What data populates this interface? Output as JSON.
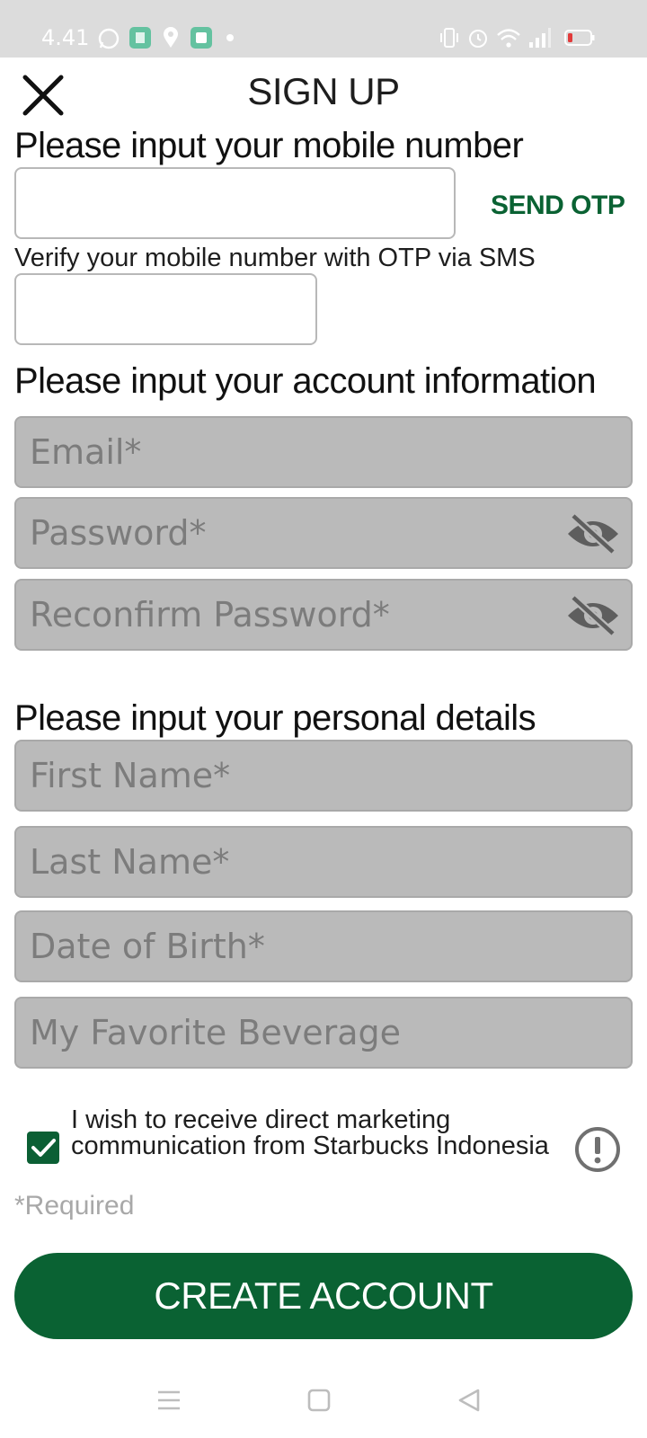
{
  "status_bar": {
    "time": "4.41",
    "left_icons": [
      "whatsapp-icon",
      "app-notification-icon",
      "location-icon",
      "app-notification-icon",
      "dot-icon"
    ],
    "right_icons": [
      "vibrate-icon",
      "alarm-icon",
      "wifi-icon",
      "signal-icon",
      "battery-low-icon"
    ]
  },
  "header": {
    "title": "SIGN UP",
    "close_icon": "close-icon"
  },
  "mobile_section": {
    "heading": "Please input your mobile number",
    "phone_value": "",
    "send_otp_label": "SEND OTP",
    "otp_hint": "Verify your mobile number with OTP via SMS",
    "otp_value": ""
  },
  "account_section": {
    "heading": "Please input your account information",
    "email_placeholder": "Email*",
    "password_placeholder": "Password*",
    "reconfirm_placeholder": "Reconfirm Password*"
  },
  "personal_section": {
    "heading": "Please input your personal details",
    "first_name_placeholder": "First Name*",
    "last_name_placeholder": "Last Name*",
    "dob_placeholder": "Date of Birth*",
    "beverage_placeholder": "My Favorite Beverage"
  },
  "marketing": {
    "checked": true,
    "text": "I wish to receive direct marketing communication from Starbucks Indonesia"
  },
  "required_note": "*Required",
  "create_account_label": "CREATE ACCOUNT",
  "colors": {
    "brand_green": "#0a6233",
    "field_gray": "#bababa",
    "status_bar_bg": "#dcdcdc"
  },
  "nav_bar": {
    "buttons": [
      "menu-icon",
      "home-icon",
      "back-icon"
    ]
  }
}
